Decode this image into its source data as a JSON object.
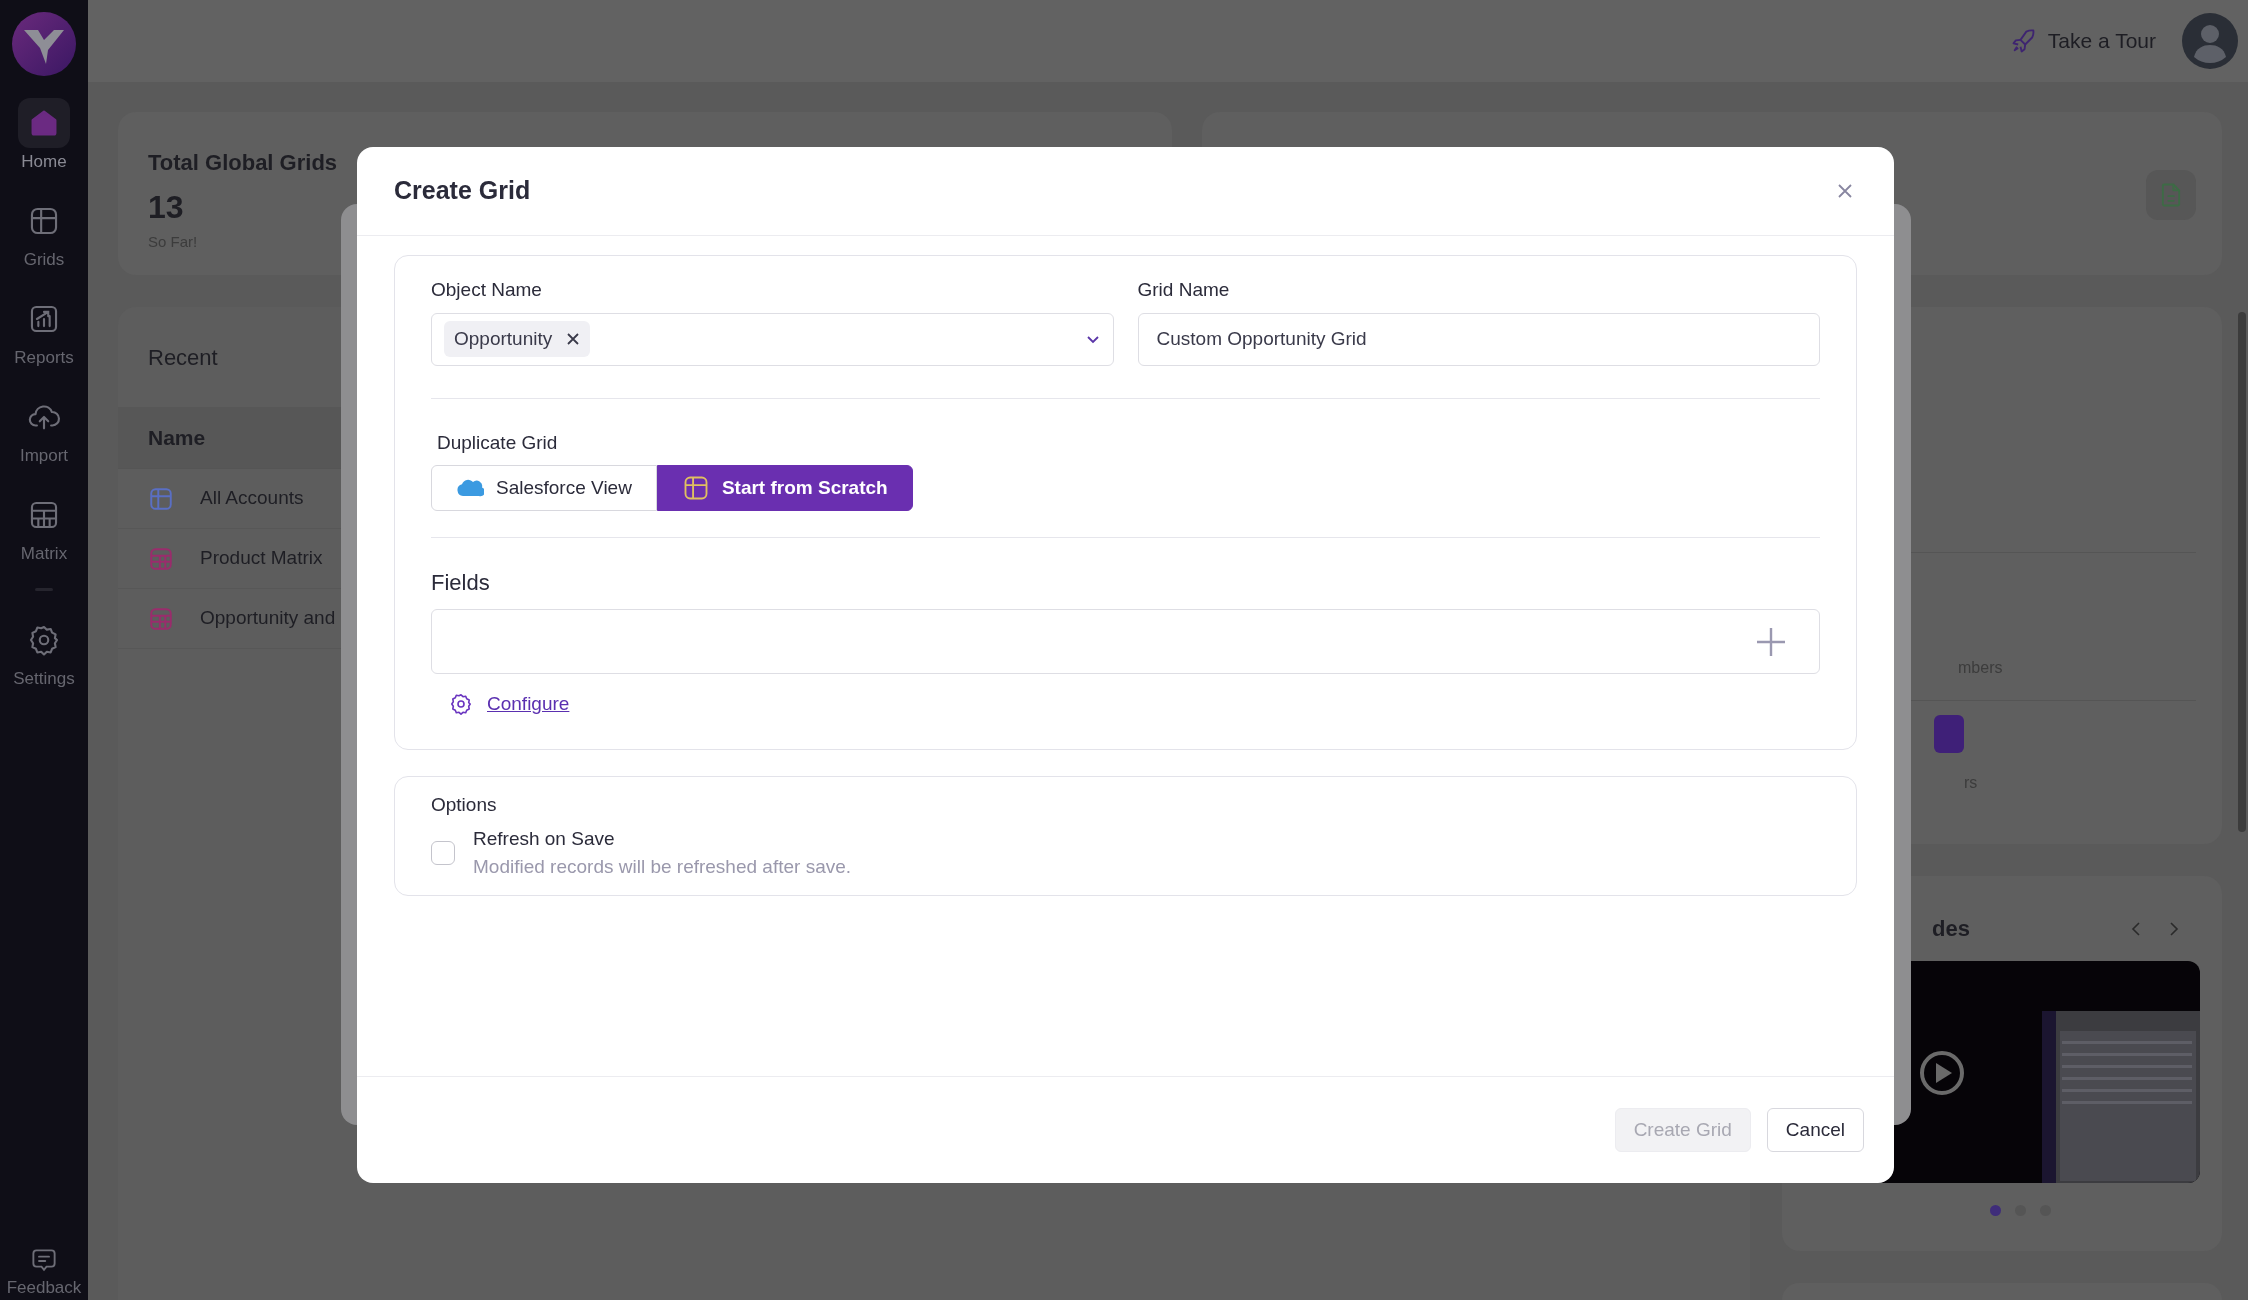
{
  "sidebar": {
    "items": [
      {
        "label": "Home",
        "selected": true
      },
      {
        "label": "Grids",
        "selected": false
      },
      {
        "label": "Reports",
        "selected": false
      },
      {
        "label": "Import",
        "selected": false
      },
      {
        "label": "Matrix",
        "selected": false
      },
      {
        "label": "Settings",
        "selected": false
      }
    ],
    "footer_item": {
      "label": "Feedback"
    }
  },
  "header": {
    "tour_link": "Take a Tour"
  },
  "summary_card": {
    "title": "Total Global Grids",
    "count": "13",
    "caption": "So Far!"
  },
  "recent": {
    "title": "Recent",
    "column": "Name",
    "rows": [
      {
        "name": "All Accounts",
        "color": "#5a6fc4"
      },
      {
        "name": "Product Matrix",
        "color": "#9a2c6c"
      },
      {
        "name": "Opportunity and",
        "color": "#9a2c6c"
      }
    ]
  },
  "right_panel": {
    "text_1": "mbers",
    "text_2": "rs"
  },
  "guides": {
    "title": "des",
    "dots": [
      {
        "selected": true
      },
      {
        "selected": false
      },
      {
        "selected": false
      }
    ]
  },
  "dialog": {
    "title": "Create Grid",
    "object_name": {
      "label": "Object Name",
      "tag": "Opportunity"
    },
    "grid_name": {
      "label": "Grid Name",
      "value": "Custom Opportunity Grid"
    },
    "duplicate_grid": {
      "label": "Duplicate Grid",
      "options": [
        {
          "label": "Salesforce View",
          "selected": false
        },
        {
          "label": "Start from Scratch",
          "selected": true
        }
      ]
    },
    "fields": {
      "label": "Fields",
      "link": "Configure"
    },
    "options": {
      "title": "Options",
      "items": [
        {
          "label": "Refresh on Save",
          "description": "Modified records will be refreshed after save.",
          "checked": false
        }
      ]
    },
    "buttons": [
      {
        "label": "Create Grid",
        "disabled": true
      },
      {
        "label": "Cancel",
        "disabled": false
      }
    ]
  }
}
